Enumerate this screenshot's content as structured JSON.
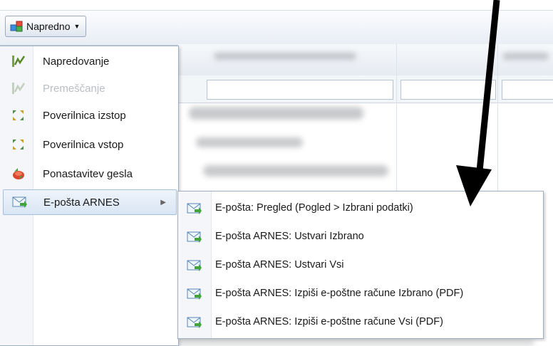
{
  "toolbar": {
    "napredno_label": "Napredno",
    "napredno_icon": "gear-cubes-icon"
  },
  "menu": {
    "items": [
      {
        "label": "Napredovanje",
        "icon": "progress-chart-icon",
        "enabled": true
      },
      {
        "label": "Premeščanje",
        "icon": "progress-chart-icon",
        "enabled": false
      },
      {
        "label": "Poverilnica izstop",
        "icon": "credential-arrows-icon",
        "enabled": true
      },
      {
        "label": "Poverilnica vstop",
        "icon": "credential-arrows-icon",
        "enabled": true
      },
      {
        "label": "Ponastavitev gesla",
        "icon": "reset-password-icon",
        "enabled": true
      },
      {
        "label": "E-pošta ARNES",
        "icon": "email-arrow-icon",
        "enabled": true,
        "has_submenu": true
      }
    ]
  },
  "submenu": {
    "items": [
      {
        "label": "E-pošta: Pregled (Pogled > Izbrani podatki)",
        "icon": "email-arrow-icon"
      },
      {
        "label": "E-pošta ARNES: Ustvari Izbrano",
        "icon": "email-arrow-icon"
      },
      {
        "label": "E-pošta ARNES: Ustvari Vsi",
        "icon": "email-arrow-icon"
      },
      {
        "label": "E-pošta ARNES: Izpiši e-poštne račune Izbrano (PDF)",
        "icon": "email-arrow-icon"
      },
      {
        "label": "E-pošta ARNES: Izpiši e-poštne račune Vsi (PDF)",
        "icon": "email-arrow-icon"
      }
    ]
  },
  "colors": {
    "accent_green": "#4a9a3a",
    "menu_border": "#9fb0c6",
    "highlight": "#d9e6f4",
    "annotation_arrow": "#000000"
  }
}
